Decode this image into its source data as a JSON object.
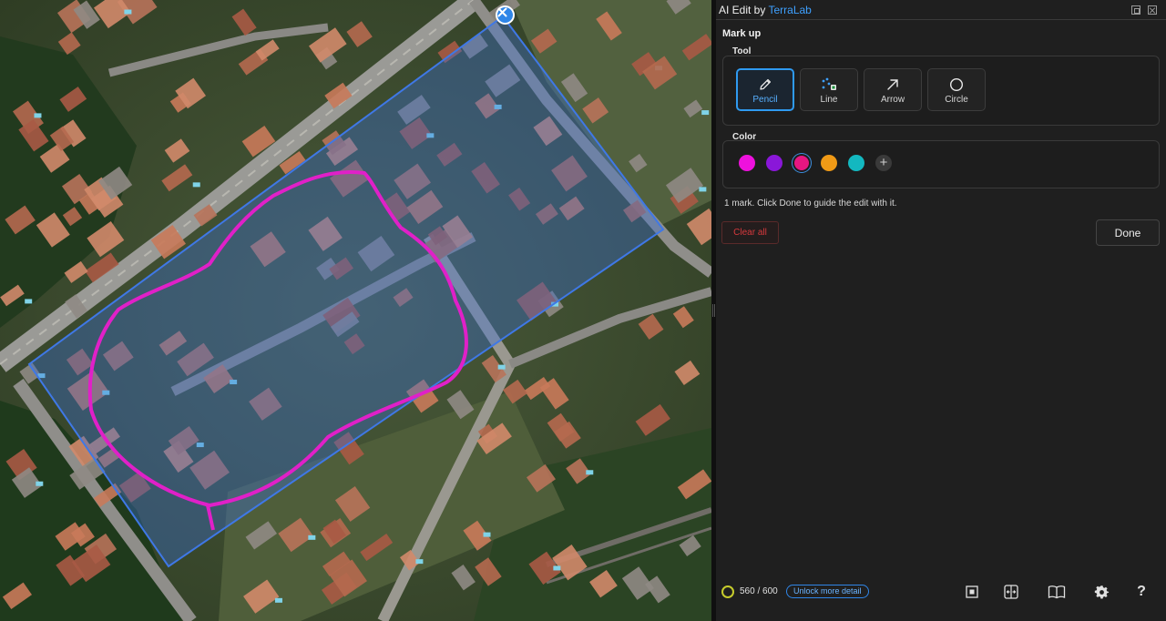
{
  "map": {
    "overlay_color": "#3b6fd4",
    "markup_color": "#e020c8"
  },
  "panel": {
    "title_prefix": "AI Edit by ",
    "title_brand": "TerraLab",
    "section_title": "Mark up",
    "tool_label": "Tool",
    "tools": [
      {
        "label": "Pencil",
        "icon": "pencil-icon",
        "active": true
      },
      {
        "label": "Line",
        "icon": "line-icon",
        "active": false
      },
      {
        "label": "Arrow",
        "icon": "arrow-icon",
        "active": false
      },
      {
        "label": "Circle",
        "icon": "circle-icon",
        "active": false
      }
    ],
    "color_label": "Color",
    "colors": [
      "#ee11dd",
      "#8a17d9",
      "#e61681",
      "#f09a16",
      "#13b8c0"
    ],
    "selected_color": "#e61681",
    "add_color_glyph": "+",
    "status": "1 mark. Click Done to guide the edit with it.",
    "clear_label": "Clear all",
    "done_label": "Done"
  },
  "footer": {
    "credits": "560 / 600",
    "unlock_label": "Unlock more detail",
    "help_glyph": "?",
    "icons": [
      "fit-icon",
      "compare-icon",
      "book-icon",
      "gear-icon",
      "help-icon"
    ]
  }
}
